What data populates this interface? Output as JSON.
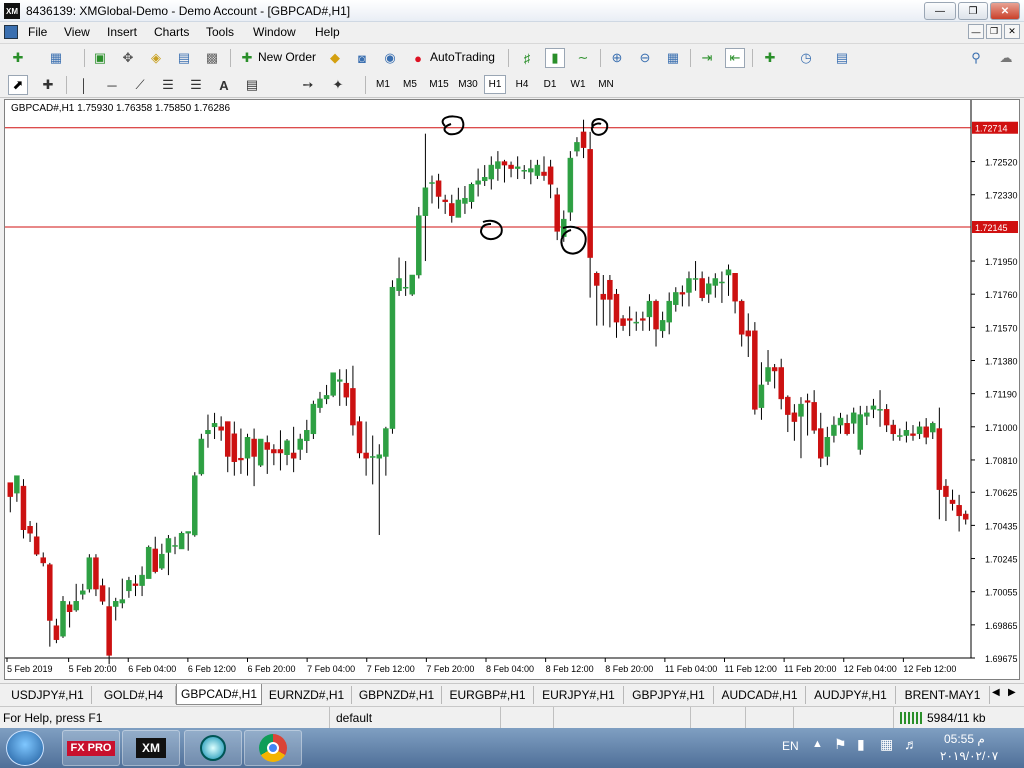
{
  "window": {
    "title": "8436139: XMGlobal-Demo - Demo Account - [GBPCAD#,H1]",
    "logo": "XM"
  },
  "menu": [
    "File",
    "View",
    "Insert",
    "Charts",
    "Tools",
    "Window",
    "Help"
  ],
  "toolbar": {
    "new_order": "New Order",
    "autotrading": "AutoTrading"
  },
  "drawing_tools": {
    "text_tool": "A"
  },
  "timeframes": [
    "M1",
    "M5",
    "M15",
    "M30",
    "H1",
    "H4",
    "D1",
    "W1",
    "MN"
  ],
  "active_timeframe": "H1",
  "chart": {
    "symbol_info": "GBPCAD#,H1  1.75930 1.76358 1.75850 1.76286"
  },
  "chart_data": {
    "type": "candlestick",
    "symbol": "GBPCAD#",
    "timeframe": "H1",
    "ohlc": [
      1.7593,
      1.76358,
      1.7585,
      1.76286
    ],
    "y_ticks": [
      "1.72714",
      "1.72520",
      "1.72330",
      "1.72145",
      "1.71950",
      "1.71760",
      "1.71570",
      "1.71380",
      "1.71190",
      "1.71000",
      "1.70810",
      "1.70625",
      "1.70435",
      "1.70245",
      "1.70055",
      "1.69865",
      "1.69675"
    ],
    "x_ticks": [
      "5 Feb 2019",
      "5 Feb 20:00",
      "6 Feb 04:00",
      "6 Feb 12:00",
      "6 Feb 20:00",
      "7 Feb 04:00",
      "7 Feb 12:00",
      "7 Feb 20:00",
      "8 Feb 04:00",
      "8 Feb 12:00",
      "8 Feb 20:00",
      "11 Feb 04:00",
      "11 Feb 12:00",
      "11 Feb 20:00",
      "12 Feb 04:00",
      "12 Feb 12:00"
    ],
    "horizontal_lines": [
      1.72714,
      1.72145
    ],
    "ylim": [
      1.69675,
      1.7285
    ],
    "colors": {
      "bull": "#2ea043",
      "bear": "#cc1111",
      "hline": "#d01010",
      "grid": "#ffffff"
    },
    "candles": [
      [
        1.7068,
        1.706,
        1.7065,
        1.7051
      ],
      [
        1.7062,
        1.7072,
        1.7057,
        1.7066
      ],
      [
        1.7066,
        1.7041,
        1.707,
        1.7036
      ],
      [
        1.7043,
        1.7039,
        1.7046,
        1.7034
      ],
      [
        1.7037,
        1.7027,
        1.7045,
        1.7026
      ],
      [
        1.7025,
        1.7022,
        1.7028,
        1.702
      ],
      [
        1.7021,
        1.6989,
        1.7022,
        1.6974
      ],
      [
        1.6986,
        1.6978,
        1.699,
        1.6976
      ],
      [
        1.698,
        1.7,
        1.7003,
        1.6979
      ],
      [
        1.6998,
        1.6994,
        1.7,
        1.6985
      ],
      [
        1.6995,
        1.7,
        1.701,
        1.6994
      ],
      [
        1.7004,
        1.7006,
        1.701,
        1.7001
      ],
      [
        1.7007,
        1.7025,
        1.7027,
        1.7005
      ],
      [
        1.7025,
        1.7007,
        1.7027,
        1.7003
      ],
      [
        1.7009,
        1.7,
        1.7013,
        1.6998
      ],
      [
        1.6997,
        1.6969,
        1.7008,
        1.6964
      ],
      [
        1.6997,
        1.7,
        1.7002,
        1.6989
      ],
      [
        1.6999,
        1.7001,
        1.7013,
        1.6996
      ],
      [
        1.7006,
        1.7012,
        1.7014,
        1.7002
      ],
      [
        1.701,
        1.7009,
        1.7015,
        1.7003
      ],
      [
        1.7009,
        1.7015,
        1.702,
        1.7003
      ],
      [
        1.7013,
        1.7031,
        1.7032,
        1.7013
      ],
      [
        1.703,
        1.7017,
        1.7037,
        1.7016
      ],
      [
        1.7019,
        1.7027,
        1.7033,
        1.7018
      ],
      [
        1.7028,
        1.7036,
        1.7038,
        1.7015
      ],
      [
        1.7032,
        1.7032,
        1.7037,
        1.7027
      ],
      [
        1.703,
        1.7039,
        1.704,
        1.703
      ],
      [
        1.7039,
        1.704,
        1.704,
        1.7029
      ],
      [
        1.7038,
        1.7072,
        1.7074,
        1.7037
      ],
      [
        1.7073,
        1.7093,
        1.7096,
        1.7072
      ],
      [
        1.7096,
        1.7098,
        1.7107,
        1.7088
      ],
      [
        1.71,
        1.7102,
        1.7108,
        1.7093
      ],
      [
        1.71,
        1.7098,
        1.7106,
        1.7092
      ],
      [
        1.7103,
        1.7083,
        1.7103,
        1.7074
      ],
      [
        1.7096,
        1.708,
        1.7103,
        1.7072
      ],
      [
        1.7082,
        1.7081,
        1.7099,
        1.7073
      ],
      [
        1.7082,
        1.7094,
        1.7096,
        1.7072
      ],
      [
        1.7093,
        1.7083,
        1.7099,
        1.7066
      ],
      [
        1.7078,
        1.7093,
        1.7093,
        1.7077
      ],
      [
        1.7091,
        1.7087,
        1.7095,
        1.7073
      ],
      [
        1.7087,
        1.7085,
        1.709,
        1.7078
      ],
      [
        1.7087,
        1.7085,
        1.7098,
        1.7075
      ],
      [
        1.7084,
        1.7092,
        1.7093,
        1.7078
      ],
      [
        1.7085,
        1.7082,
        1.71,
        1.7074
      ],
      [
        1.7087,
        1.7093,
        1.7096,
        1.7081
      ],
      [
        1.7092,
        1.7098,
        1.7104,
        1.7085
      ],
      [
        1.7096,
        1.7113,
        1.7115,
        1.7093
      ],
      [
        1.7111,
        1.7116,
        1.712,
        1.7108
      ],
      [
        1.7116,
        1.7118,
        1.7124,
        1.7113
      ],
      [
        1.7118,
        1.7131,
        1.7131,
        1.7117
      ],
      [
        1.7126,
        1.7127,
        1.7133,
        1.7112
      ],
      [
        1.7125,
        1.7117,
        1.7133,
        1.7112
      ],
      [
        1.7122,
        1.7101,
        1.7135,
        1.7095
      ],
      [
        1.7103,
        1.7085,
        1.7106,
        1.7082
      ],
      [
        1.7085,
        1.7082,
        1.7103,
        1.7072
      ],
      [
        1.7083,
        1.7083,
        1.7095,
        1.7067
      ],
      [
        1.7082,
        1.7084,
        1.709,
        1.7038
      ],
      [
        1.7083,
        1.7099,
        1.71,
        1.7072
      ],
      [
        1.7099,
        1.718,
        1.7184,
        1.7096
      ],
      [
        1.7178,
        1.7185,
        1.7197,
        1.7175
      ],
      [
        1.718,
        1.718,
        1.7195,
        1.7175
      ],
      [
        1.7176,
        1.7187,
        1.7187,
        1.7175
      ],
      [
        1.7187,
        1.7221,
        1.7226,
        1.7185
      ],
      [
        1.7221,
        1.7237,
        1.7268,
        1.7195
      ],
      [
        1.724,
        1.724,
        1.7244,
        1.7228
      ],
      [
        1.7241,
        1.7232,
        1.7245,
        1.7225
      ],
      [
        1.723,
        1.7229,
        1.7233,
        1.7222
      ],
      [
        1.7228,
        1.7221,
        1.7233,
        1.7217
      ],
      [
        1.722,
        1.723,
        1.7237,
        1.722
      ],
      [
        1.7228,
        1.7231,
        1.7238,
        1.7222
      ],
      [
        1.7229,
        1.7239,
        1.724,
        1.7225
      ],
      [
        1.7239,
        1.7241,
        1.7248,
        1.7232
      ],
      [
        1.7241,
        1.7243,
        1.725,
        1.7238
      ],
      [
        1.7242,
        1.725,
        1.7255,
        1.7236
      ],
      [
        1.7248,
        1.7252,
        1.7258,
        1.7241
      ],
      [
        1.7252,
        1.725,
        1.7253,
        1.724
      ],
      [
        1.725,
        1.7248,
        1.7252,
        1.7243
      ],
      [
        1.7248,
        1.7249,
        1.7255,
        1.7242
      ],
      [
        1.7247,
        1.7247,
        1.725,
        1.7242
      ],
      [
        1.7246,
        1.7248,
        1.7253,
        1.7239
      ],
      [
        1.7244,
        1.725,
        1.7253,
        1.7242
      ],
      [
        1.7246,
        1.7244,
        1.7255,
        1.7241
      ],
      [
        1.7249,
        1.7239,
        1.7253,
        1.7231
      ],
      [
        1.7233,
        1.7212,
        1.7237,
        1.7207
      ],
      [
        1.7209,
        1.7219,
        1.7224,
        1.7206
      ],
      [
        1.7223,
        1.7254,
        1.7258,
        1.7218
      ],
      [
        1.7258,
        1.7263,
        1.7266,
        1.7255
      ],
      [
        1.7269,
        1.726,
        1.7276,
        1.7254
      ],
      [
        1.7259,
        1.7197,
        1.7269,
        1.7174
      ],
      [
        1.7188,
        1.7181,
        1.7189,
        1.7158
      ],
      [
        1.7176,
        1.7173,
        1.7187,
        1.7158
      ],
      [
        1.7184,
        1.7173,
        1.7187,
        1.7157
      ],
      [
        1.7176,
        1.716,
        1.7179,
        1.7151
      ],
      [
        1.7162,
        1.7158,
        1.7164,
        1.7155
      ],
      [
        1.7162,
        1.7161,
        1.7169,
        1.7152
      ],
      [
        1.716,
        1.716,
        1.7166,
        1.7155
      ],
      [
        1.7162,
        1.7161,
        1.7166,
        1.7155
      ],
      [
        1.7163,
        1.7172,
        1.7176,
        1.7155
      ],
      [
        1.7172,
        1.7156,
        1.7173,
        1.7146
      ],
      [
        1.7155,
        1.7161,
        1.7166,
        1.7151
      ],
      [
        1.716,
        1.7172,
        1.7177,
        1.7153
      ],
      [
        1.717,
        1.7177,
        1.718,
        1.7166
      ],
      [
        1.7177,
        1.7176,
        1.7181,
        1.7169
      ],
      [
        1.7177,
        1.7185,
        1.7189,
        1.7169
      ],
      [
        1.7185,
        1.7185,
        1.7195,
        1.7178
      ],
      [
        1.7185,
        1.7174,
        1.7189,
        1.7172
      ],
      [
        1.7176,
        1.7182,
        1.7186,
        1.7171
      ],
      [
        1.7181,
        1.7185,
        1.7188,
        1.7174
      ],
      [
        1.7183,
        1.7183,
        1.7189,
        1.7171
      ],
      [
        1.7187,
        1.719,
        1.7193,
        1.7175
      ],
      [
        1.7188,
        1.7172,
        1.7188,
        1.7165
      ],
      [
        1.7172,
        1.7153,
        1.7173,
        1.7146
      ],
      [
        1.7155,
        1.7152,
        1.7165,
        1.714
      ],
      [
        1.7155,
        1.711,
        1.716,
        1.7107
      ],
      [
        1.7111,
        1.7124,
        1.7137,
        1.7104
      ],
      [
        1.7126,
        1.7134,
        1.7144,
        1.7124
      ],
      [
        1.7134,
        1.7132,
        1.7136,
        1.7122
      ],
      [
        1.7134,
        1.7116,
        1.7139,
        1.711
      ],
      [
        1.7117,
        1.7107,
        1.7118,
        1.7097
      ],
      [
        1.7108,
        1.7103,
        1.7113,
        1.7092
      ],
      [
        1.7106,
        1.7113,
        1.7117,
        1.7082
      ],
      [
        1.7115,
        1.7114,
        1.7119,
        1.7095
      ],
      [
        1.7114,
        1.7098,
        1.7121,
        1.7096
      ],
      [
        1.7099,
        1.7082,
        1.7108,
        1.7077
      ],
      [
        1.7083,
        1.7094,
        1.71,
        1.7078
      ],
      [
        1.7095,
        1.7101,
        1.7106,
        1.7091
      ],
      [
        1.7101,
        1.7105,
        1.7108,
        1.7096
      ],
      [
        1.7102,
        1.7096,
        1.7107,
        1.7095
      ],
      [
        1.7102,
        1.7108,
        1.7111,
        1.7096
      ],
      [
        1.7087,
        1.7107,
        1.7112,
        1.7084
      ],
      [
        1.7106,
        1.7108,
        1.7112,
        1.7101
      ],
      [
        1.711,
        1.7112,
        1.7116,
        1.7105
      ],
      [
        1.711,
        1.711,
        1.7121,
        1.71
      ],
      [
        1.711,
        1.7101,
        1.7113,
        1.7097
      ],
      [
        1.7101,
        1.7096,
        1.7104,
        1.7092
      ],
      [
        1.7095,
        1.7095,
        1.7099,
        1.7092
      ],
      [
        1.7095,
        1.7098,
        1.7103,
        1.7091
      ],
      [
        1.7096,
        1.7095,
        1.7101,
        1.7092
      ],
      [
        1.7096,
        1.71,
        1.7103,
        1.7093
      ],
      [
        1.71,
        1.7094,
        1.7105,
        1.709
      ],
      [
        1.7097,
        1.7102,
        1.7103,
        1.7093
      ],
      [
        1.7099,
        1.7064,
        1.7111,
        1.7047
      ],
      [
        1.7066,
        1.706,
        1.707,
        1.7046
      ],
      [
        1.7058,
        1.7056,
        1.7064,
        1.7052
      ],
      [
        1.7055,
        1.7049,
        1.7061,
        1.704
      ],
      [
        1.705,
        1.7047,
        1.7052,
        1.7044
      ]
    ]
  },
  "symbol_tabs": [
    "USDJPY#,H1",
    "GOLD#,H4",
    "GBPCAD#,H1",
    "EURNZD#,H1",
    "GBPNZD#,H1",
    "EURGBP#,H1",
    "EURJPY#,H1",
    "GBPJPY#,H1",
    "AUDCAD#,H1",
    "AUDJPY#,H1",
    "BRENT-MAY1"
  ],
  "active_tab": "GBPCAD#,H1",
  "status": {
    "help": "For Help, press F1",
    "profile": "default",
    "traffic": "5984/11 kb"
  },
  "taskbar": {
    "language": "EN",
    "time": "05:55 م",
    "date": "٢٠١٩/٠٢/٠٧",
    "apps": [
      "FX PRO",
      "XM"
    ]
  }
}
